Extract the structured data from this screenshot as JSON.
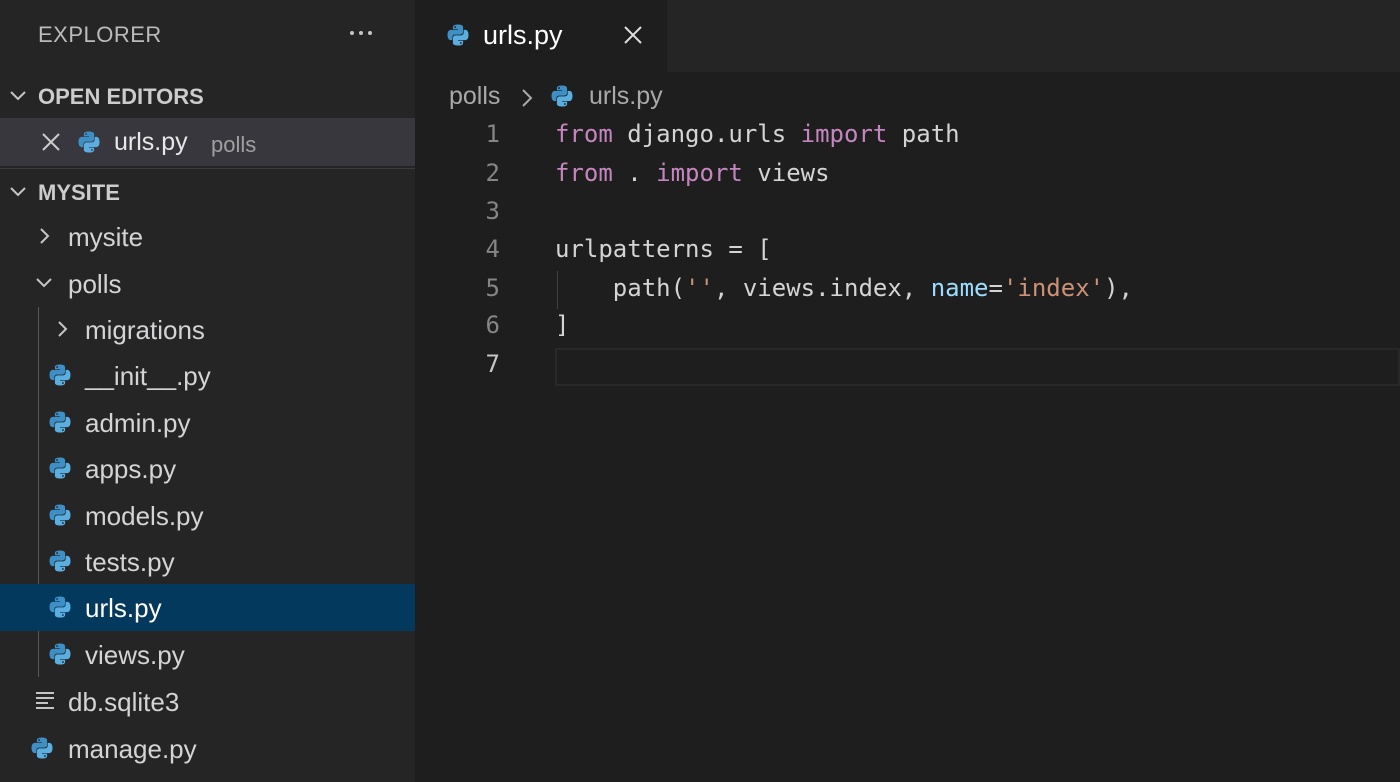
{
  "sidebar": {
    "title": "EXPLORER",
    "more_icon": "ellipsis-icon",
    "open_editors": {
      "header": "OPEN EDITORS",
      "items": [
        {
          "name": "urls.py",
          "dir": "polls",
          "icon": "python-icon"
        }
      ]
    },
    "workspace": {
      "header": "MYSITE",
      "tree": [
        {
          "name": "mysite",
          "type": "folder",
          "expanded": false
        },
        {
          "name": "polls",
          "type": "folder",
          "expanded": true
        },
        {
          "name": "migrations",
          "type": "folder",
          "expanded": false
        },
        {
          "name": "__init__.py",
          "type": "file",
          "icon": "python-icon"
        },
        {
          "name": "admin.py",
          "type": "file",
          "icon": "python-icon"
        },
        {
          "name": "apps.py",
          "type": "file",
          "icon": "python-icon"
        },
        {
          "name": "models.py",
          "type": "file",
          "icon": "python-icon"
        },
        {
          "name": "tests.py",
          "type": "file",
          "icon": "python-icon"
        },
        {
          "name": "urls.py",
          "type": "file",
          "icon": "python-icon",
          "selected": true
        },
        {
          "name": "views.py",
          "type": "file",
          "icon": "python-icon"
        },
        {
          "name": "db.sqlite3",
          "type": "file",
          "icon": "text-lines-icon"
        },
        {
          "name": "manage.py",
          "type": "file",
          "icon": "python-icon"
        }
      ]
    }
  },
  "tab": {
    "label": "urls.py",
    "icon": "python-icon"
  },
  "breadcrumb": {
    "folder": "polls",
    "file": "urls.py"
  },
  "editor": {
    "active_line": 7,
    "line_numbers": [
      "1",
      "2",
      "3",
      "4",
      "5",
      "6",
      "7"
    ],
    "lines": [
      [
        "from",
        " django.urls ",
        "import",
        " path"
      ],
      [
        "from",
        " . ",
        "import",
        " views"
      ],
      [],
      [
        "urlpatterns = ["
      ],
      [
        "    path(",
        "''",
        ", views.index, ",
        "name",
        "=",
        "'index'",
        "),"
      ],
      [
        "]"
      ],
      []
    ]
  },
  "colors": {
    "sidebar_bg": "#252526",
    "editor_bg": "#1e1e1e",
    "selection_bg": "#04395e",
    "keyword": "#c586c0",
    "string": "#ce9178",
    "parameter": "#9cdcfe",
    "python_blue": "#3c8cbf",
    "python_yellow": "#4aa3d6"
  }
}
